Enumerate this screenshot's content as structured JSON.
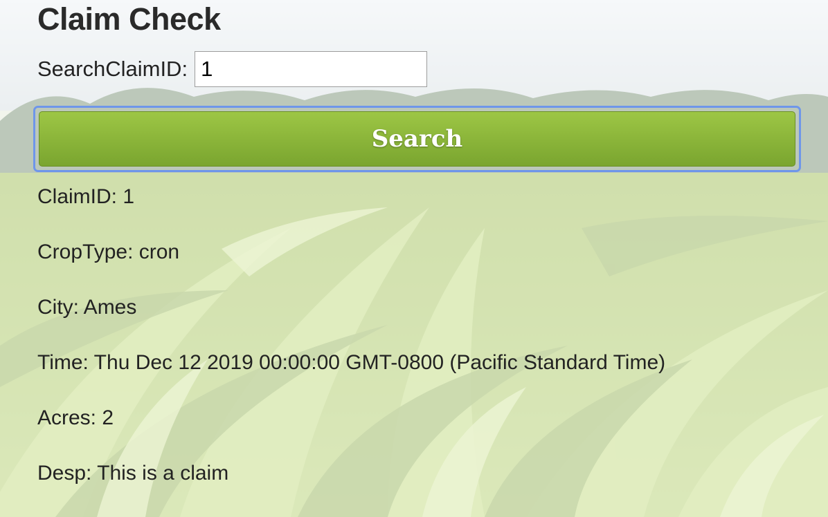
{
  "page": {
    "title": "Claim Check"
  },
  "search": {
    "label": "SearchClaimID:",
    "value": "1",
    "button_label": "Search"
  },
  "result": {
    "claim_id": "ClaimID: 1",
    "crop_type": "CropType: cron",
    "city": "City: Ames",
    "time": "Time: Thu Dec 12 2019 00:00:00 GMT-0800 (Pacific Standard Time)",
    "acres": "Acres: 2",
    "desc": "Desp: This is a claim"
  },
  "colors": {
    "button_green_top": "#9dc645",
    "button_green_bottom": "#7aa52f",
    "focus_ring": "#6e96ea"
  }
}
